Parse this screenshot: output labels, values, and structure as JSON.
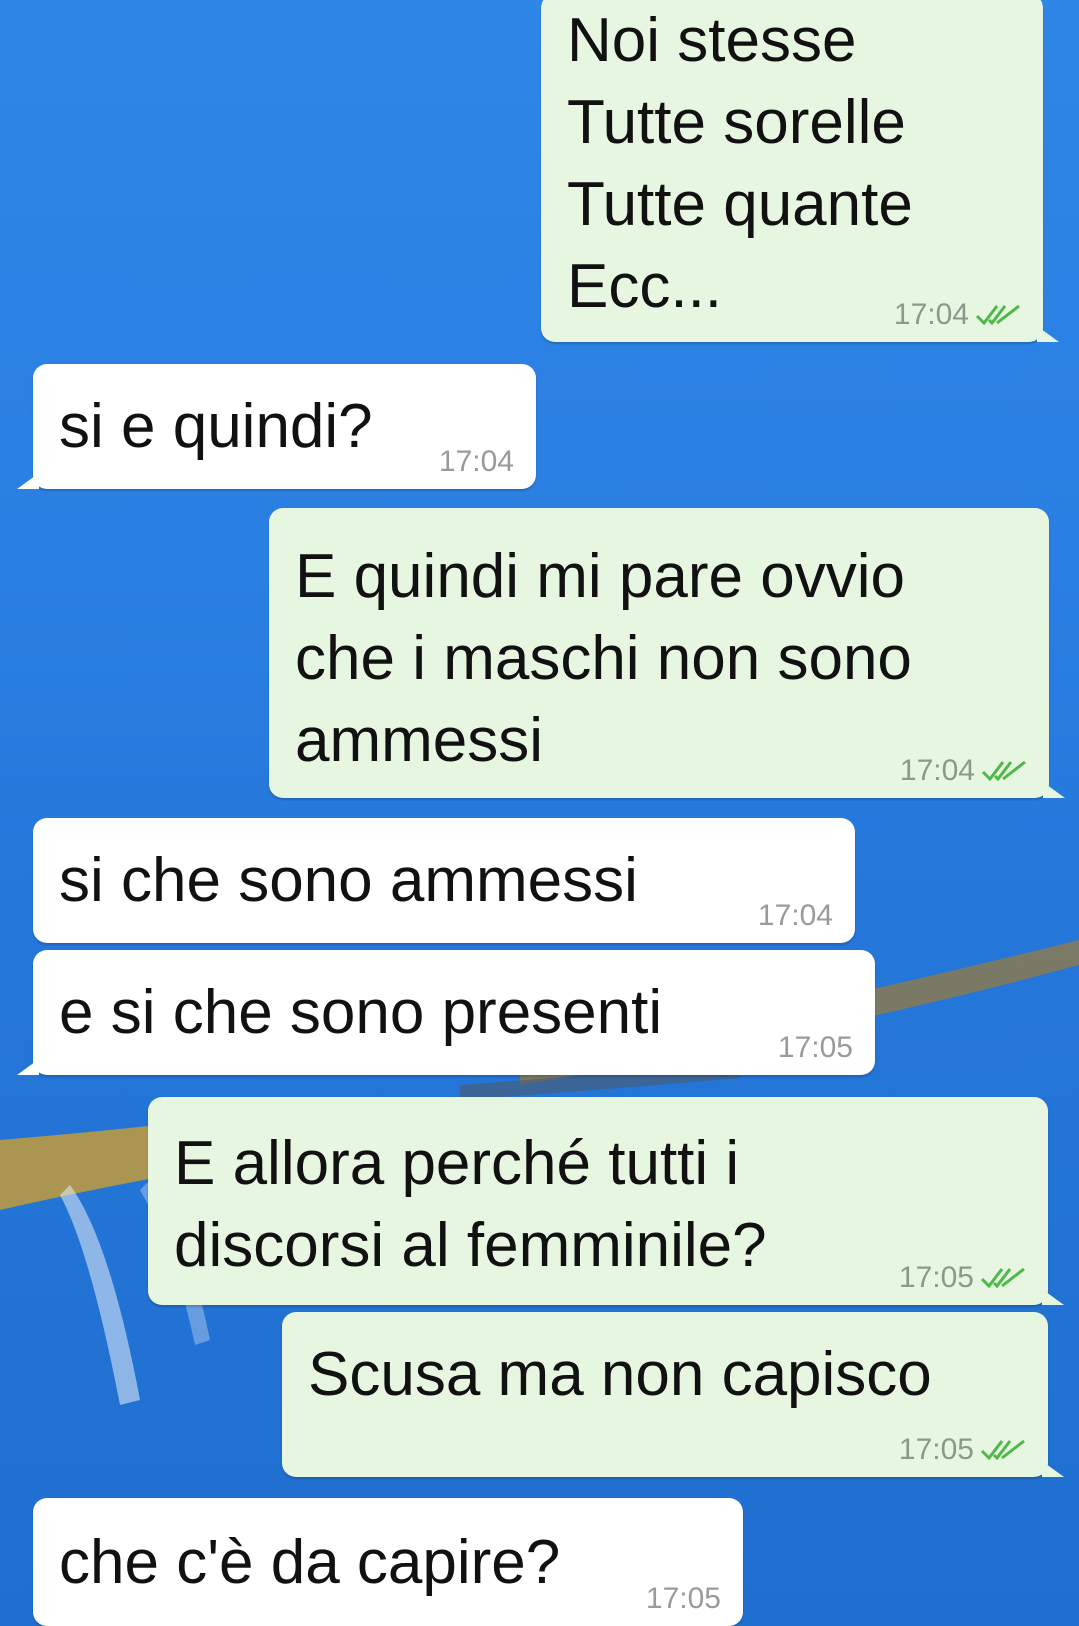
{
  "messages": [
    {
      "direction": "out",
      "lines": [
        "Noi stesse",
        "Tutte sorelle",
        "Tutte quante",
        "Ecc..."
      ],
      "time": "17:04",
      "status": "read"
    },
    {
      "direction": "in",
      "lines": [
        "si e quindi?"
      ],
      "time": "17:04"
    },
    {
      "direction": "out",
      "lines": [
        "E quindi mi pare ovvio",
        "che i maschi non sono",
        "ammessi"
      ],
      "time": "17:04",
      "status": "read"
    },
    {
      "direction": "in",
      "lines": [
        "si che sono ammessi"
      ],
      "time": "17:04"
    },
    {
      "direction": "in",
      "lines": [
        "e si che sono presenti"
      ],
      "time": "17:05"
    },
    {
      "direction": "out",
      "lines": [
        "E allora perché tutti i",
        "discorsi al femminile?"
      ],
      "time": "17:05",
      "status": "read"
    },
    {
      "direction": "out",
      "lines": [
        "Scusa ma non capisco"
      ],
      "time": "17:05",
      "status": "read"
    },
    {
      "direction": "in",
      "lines": [
        "che c'è da capire?"
      ],
      "time": "17:05"
    }
  ],
  "icons": {
    "read_receipt": "double-check-icon"
  },
  "colors": {
    "outgoing_bubble": "#e7f6e1",
    "incoming_bubble": "#ffffff",
    "read_check": "#4fb848",
    "wallpaper_blue": "#2a7fe2"
  }
}
